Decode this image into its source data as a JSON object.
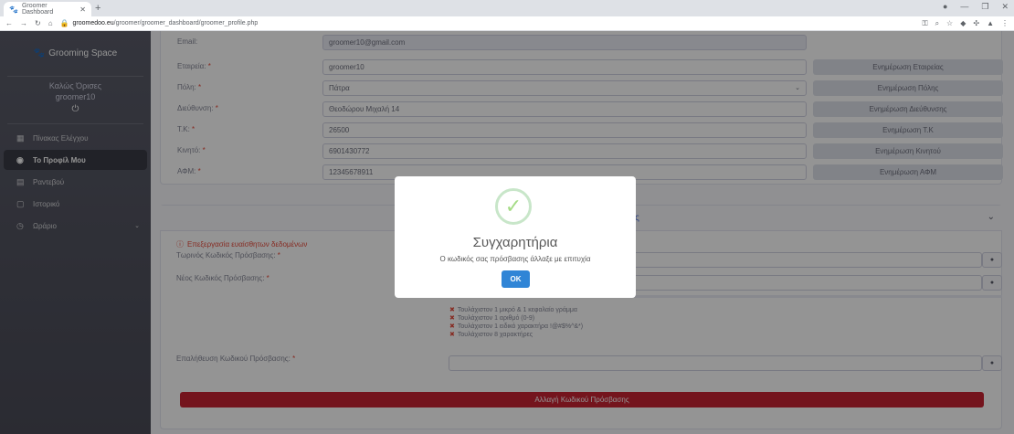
{
  "browser": {
    "tab_title": "Groomer Dashboard",
    "url_host": "groomedoo.eu",
    "url_path": "/groomer/groomer_dashboard/groomer_profile.php"
  },
  "sidebar": {
    "brand": "Grooming Space",
    "welcome": "Καλώς Όρισες",
    "username": "groomer10",
    "items": [
      {
        "label": "Πίνακας Ελέγχου",
        "icon": "dashboard-icon"
      },
      {
        "label": "Το Προφίλ Μου",
        "icon": "user-circle-icon"
      },
      {
        "label": "Ραντεβού",
        "icon": "calendar-icon"
      },
      {
        "label": "Ιστορικό",
        "icon": "history-icon"
      },
      {
        "label": "Ωράριο",
        "icon": "clock-icon"
      }
    ]
  },
  "profile": {
    "fields": [
      {
        "label": "Email:",
        "value": "groomer10@gmail.com",
        "required": false,
        "update": ""
      },
      {
        "label": "Εταιρεία:",
        "value": "groomer10",
        "required": true,
        "update": "Ενημέρωση Εταιρείας"
      },
      {
        "label": "Πόλη:",
        "value": "Πάτρα",
        "required": true,
        "update": "Ενημέρωση Πόλης"
      },
      {
        "label": "Διεύθυνση:",
        "value": "Θεοδώρου Μιχαλή 14",
        "required": true,
        "update": "Ενημέρωση Διεύθυνσης"
      },
      {
        "label": "Τ.Κ:",
        "value": "26500",
        "required": true,
        "update": "Ενημέρωση Τ.Κ"
      },
      {
        "label": "Κινητό:",
        "value": "6901430772",
        "required": true,
        "update": "Ενημέρωση Κινητού"
      },
      {
        "label": "ΑΦΜ:",
        "value": "12345678911",
        "required": true,
        "update": "Ενημέρωση ΑΦΜ"
      }
    ]
  },
  "password": {
    "header_tail": "ς",
    "warning": "Επεξεργασία ευαίσθητων δεδομένων",
    "current_label": "Τωρινός Κωδικός Πρόσβασης:",
    "new_label": "Νέος Κωδικός Πρόσβασης:",
    "confirm_label": "Επαλήθευση Κωδικού Πρόσβασης:",
    "rules": [
      "Τουλάχιστον 1 μικρό & 1 κεφαλαίο γράμμα",
      "Τουλάχιστον 1 αριθμό (0-9)",
      "Τουλάχιστον 1 ειδικό χαρακτήρα !@#$%^&*)",
      "Τουλάχιστον 8 χαρακτήρες"
    ],
    "submit": "Αλλαγή Κωδικού Πρόσβασης"
  },
  "modal": {
    "title": "Συγχαρητήρια",
    "text": "Ο κωδικός σας πρόσβασης άλλαξε με επιτυχία",
    "ok": "OK"
  },
  "required_mark": "*"
}
